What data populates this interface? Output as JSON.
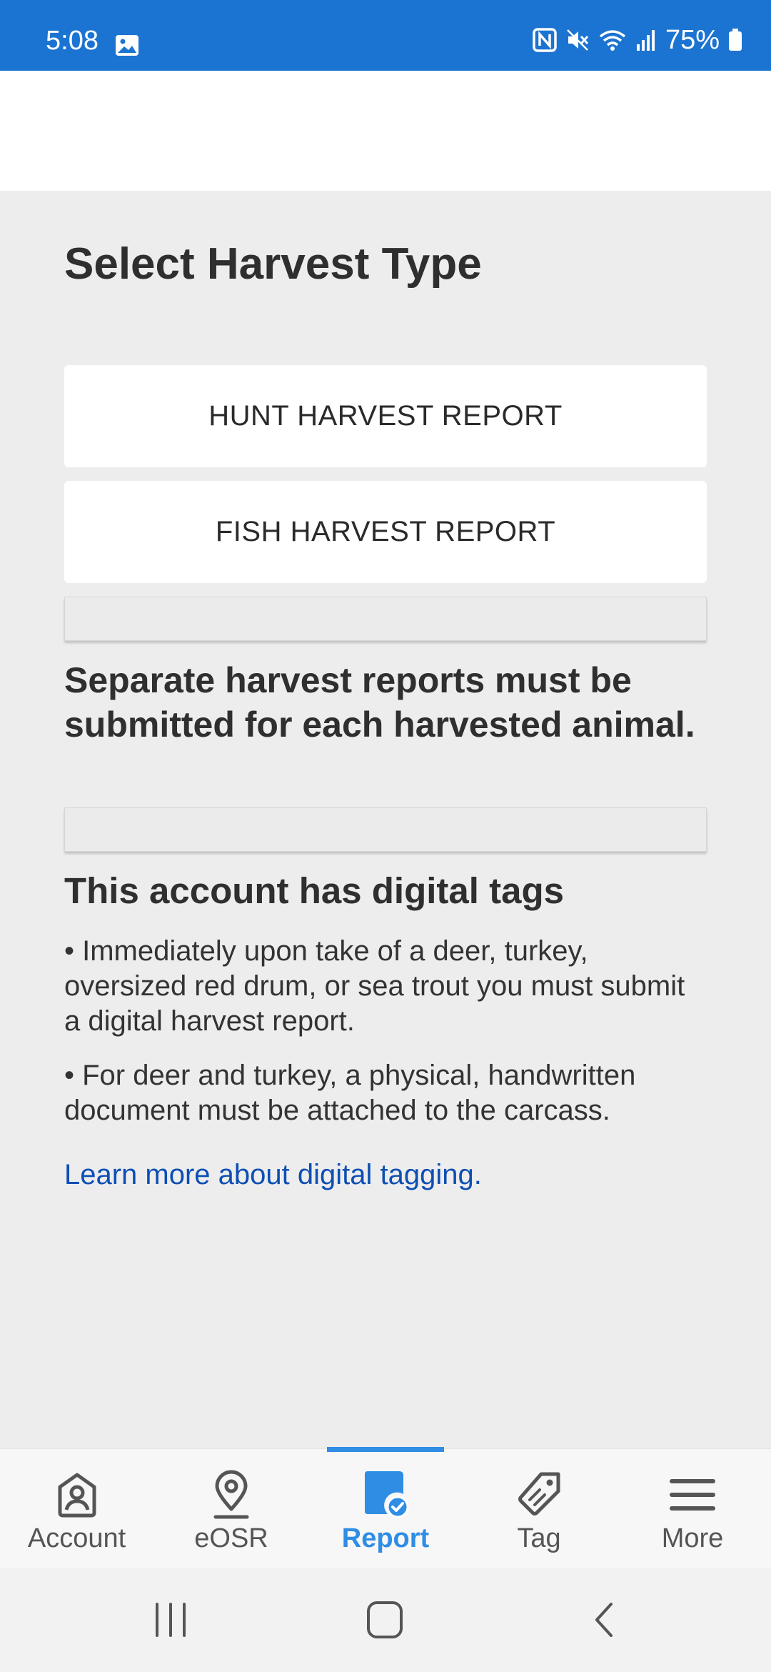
{
  "status_bar": {
    "time": "5:08",
    "battery": "75%",
    "icons": [
      "photo-icon",
      "nfc-icon",
      "mute-icon",
      "wifi-icon",
      "signal-icon",
      "battery-icon"
    ]
  },
  "page": {
    "title": "Select Harvest Type",
    "options": [
      {
        "label": "HUNT HARVEST REPORT"
      },
      {
        "label": "FISH HARVEST REPORT"
      }
    ],
    "notice": "Separate harvest reports must be submitted for each harvested animal.",
    "digital_tags": {
      "heading": "This account has digital tags",
      "bullets": [
        "• Immediately upon take of a deer, turkey, oversized red drum, or sea trout you must submit a digital harvest report.",
        "• For deer and turkey, a physical, handwritten document must be attached to the carcass."
      ],
      "link": "Learn more about digital tagging."
    }
  },
  "bottom_nav": {
    "active": "Report",
    "items": [
      {
        "label": "Account",
        "icon": "account-icon"
      },
      {
        "label": "eOSR",
        "icon": "location-pin-icon"
      },
      {
        "label": "Report",
        "icon": "report-icon"
      },
      {
        "label": "Tag",
        "icon": "tag-icon"
      },
      {
        "label": "More",
        "icon": "menu-icon"
      }
    ]
  },
  "colors": {
    "status_bar": "#1b74d1",
    "accent": "#2f8de4",
    "link": "#0d4fb3",
    "background": "#ededee"
  }
}
